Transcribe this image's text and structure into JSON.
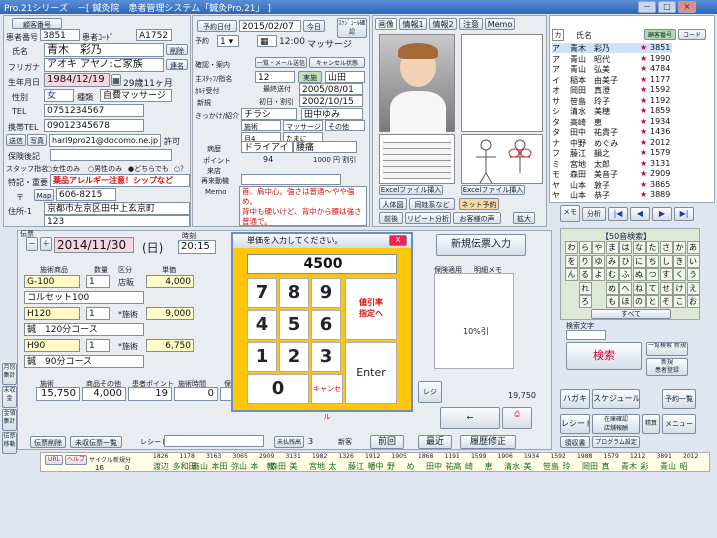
{
  "window": {
    "title": "Pro.21シリーズ　－[ 鍼灸院　患者管理システム「鍼灸Pro.21」 ]",
    "min": "－",
    "max": "□",
    "close": "×"
  },
  "left_top": {
    "print_card": "顧客番号",
    "patient_no_label": "患者番号",
    "patient_no": "3851",
    "barcode_label": "患者ｺｰﾄﾞ",
    "barcode": "A1752",
    "name_label": "氏名",
    "name": "青木　彩乃",
    "kana_label": "フリガナ",
    "kana": "アオキ アヤノ:ご家族",
    "delete_btn": "削除",
    "link_btn": "連名",
    "birth_label": "生年月日",
    "birth": "1984/12/19",
    "age": "29歳11ヶ月",
    "sex_label": "性別",
    "sex": "女",
    "type_label": "種類",
    "type": "自費マッサージ",
    "tel_label": "TEL",
    "tel": "0751234567",
    "mobile_label": "携帯TEL",
    "mobile": "09012345678",
    "mail_btn1": "送信",
    "mail_btn2": "写真",
    "email": "hari9pro21@docomo.ne.jp",
    "permit": "許可",
    "ins_label": "保険後記",
    "staff_label": "スタッフ指名",
    "staff_opts": [
      "女性のみ",
      "男性のみ",
      "どちらでも",
      "？"
    ],
    "note_label": "特記・重要",
    "note": "薬品アレルギー注意！シップなど",
    "zip_label": "〒",
    "map_btn": "Map",
    "zip": "606-8215",
    "addr_label": "住所-1",
    "addr1": "京都市左京区田中上玄京町",
    "addr2": "123"
  },
  "mid_top": {
    "reserve_btn": "予約日付",
    "date": "2015/02/07",
    "today": "今日",
    "schedule_btn": "ｽｹｼﾞｭｰﾙ確認",
    "reserve_label": "予約",
    "time": "12:00",
    "menu": "マッサージ",
    "confirm_label": "確認・案内",
    "list_btn": "一覧・メール送信",
    "cancel_btn": "キャンセル状態",
    "mainstaff_label": "主ｽﾀｯﾌ/指名",
    "mainstaff": "12",
    "actual": "実施",
    "staffname": "山田",
    "visit_label": "ｶﾙﾃ受付",
    "last_label": "最終送付",
    "last": "2005/08/01",
    "first_label": "新規",
    "first_lbl2": "初日・割引",
    "first": "2002/10/15",
    "intro_label": "きっかけ/紹介",
    "intro": "チラシ",
    "intro_name": "田中ゆみ",
    "ref1": "施術",
    "ref2": "マッサージ",
    "ref3": "その他",
    "ref4": "月4",
    "ref5": "たまに",
    "part_label": "病歴",
    "part1": "ドライアイ",
    "part2": "腰痛",
    "point_label": "ポイント",
    "point": "94",
    "yen": "1000 円 割引",
    "shop_label": "来店",
    "shop2": "再来動機",
    "memo_label": "Memo",
    "memo": "首、肩中心。強さは普通〜やや強め。\n背中も硬いけど、背中から腰は強さ普通で。"
  },
  "image_tabs": [
    "画像",
    "情報1",
    "情報2",
    "注意",
    "Memo"
  ],
  "image_panel": {
    "excel1": "Excelファイル挿入",
    "excel2": "Excelファイル挿入",
    "person": "人体図",
    "same": "同姓系など",
    "net": "ネット予約",
    "btns": [
      "前後",
      "リピート分析",
      "お客様の声",
      "拡大"
    ]
  },
  "right_list": {
    "head": [
      "カ",
      "氏名",
      "顧客番号",
      "コード"
    ],
    "rows": [
      {
        "kana": "ア",
        "name": "青木　彩乃",
        "no": "3851",
        "code": "A1752"
      },
      {
        "kana": "ア",
        "name": "青山　昭代",
        "no": "1990",
        "code": ""
      },
      {
        "kana": "ア",
        "name": "青山　弘美",
        "no": "4784",
        "code": ""
      },
      {
        "kana": "イ",
        "name": "稲本　由美子",
        "no": "1177",
        "code": ""
      },
      {
        "kana": "オ",
        "name": "岡田　真澄",
        "no": "1592",
        "code": ""
      },
      {
        "kana": "サ",
        "name": "笹島　玲子",
        "no": "1192",
        "code": ""
      },
      {
        "kana": "シ",
        "name": "清水　美穂",
        "no": "1859",
        "code": ""
      },
      {
        "kana": "タ",
        "name": "高崎　恵",
        "no": "1934",
        "code": ""
      },
      {
        "kana": "タ",
        "name": "田中　祐貴子",
        "no": "1436",
        "code": ""
      },
      {
        "kana": "ナ",
        "name": "中野　めぐみ",
        "no": "2012",
        "code": ""
      },
      {
        "kana": "フ",
        "name": "藤江　韻之",
        "no": "1579",
        "code": ""
      },
      {
        "kana": "ミ",
        "name": "宮地　太郎",
        "no": "3131",
        "code": ""
      },
      {
        "kana": "モ",
        "name": "森田　美音子",
        "no": "2909",
        "code": ""
      },
      {
        "kana": "ヤ",
        "name": "山本　敦子",
        "no": "3865",
        "code": ""
      },
      {
        "kana": "ヤ",
        "name": "山本　恭子",
        "no": "3889",
        "code": ""
      }
    ],
    "memo": "メモ",
    "analysis": "分析"
  },
  "kana_panel": {
    "title": "【50音検索】",
    "rows": [
      [
        "わ",
        "ら",
        "や",
        "ま",
        "は",
        "な",
        "た",
        "さ",
        "か",
        "あ"
      ],
      [
        "を",
        "り",
        "ゆ",
        "み",
        "ひ",
        "に",
        "ち",
        "し",
        "き",
        "い"
      ],
      [
        "ん",
        "る",
        "よ",
        "む",
        "ふ",
        "ぬ",
        "つ",
        "す",
        "く",
        "う"
      ],
      [
        "",
        "れ",
        "",
        "め",
        "へ",
        "ね",
        "て",
        "せ",
        "け",
        "え"
      ],
      [
        "",
        "ろ",
        "",
        "も",
        "ほ",
        "の",
        "と",
        "そ",
        "こ",
        "お"
      ]
    ],
    "all": "すべて",
    "search_label": "検索文字",
    "search_btn": "検索",
    "new_search": "一覧検索 新規",
    "new_reg": "新規\n患者登録"
  },
  "bottom_right": {
    "postcard": "ハガキ",
    "schedule": "スケジュール",
    "num": "予約一覧",
    "receipt": "レシート",
    "recv": "在庫確認\n店舗報酬",
    "payday": "精算",
    "ledger": "領収書",
    "prog": "プログラム設定",
    "menu": "メニュー"
  },
  "slip": {
    "label": "伝票",
    "date": "2014/11/30",
    "dow": "(日)",
    "time_label": "時刻",
    "time": "20:15",
    "new_slip": "新規伝票入力",
    "headers": [
      "施術商品",
      "数量",
      "区分",
      "単価"
    ],
    "items": [
      {
        "code": "G-100",
        "qty": "1",
        "kind": "店販",
        "price": "4,000"
      },
      {
        "code": "コルセット100",
        "qty": "",
        "kind": "",
        "price": ""
      },
      {
        "code": "H120",
        "qty": "1",
        "kind": "*施術",
        "price": "9,000"
      },
      {
        "code": "鍼　120分コース",
        "qty": "",
        "kind": "",
        "price": ""
      },
      {
        "code": "H90",
        "qty": "1",
        "kind": "*施術",
        "price": "6,750"
      },
      {
        "code": "鍼　90分コース",
        "qty": "",
        "kind": "",
        "price": ""
      }
    ],
    "tot_headers": [
      "施術",
      "商品その他",
      "患者ポイント",
      "施術時間",
      "保険適用"
    ],
    "tot_vals": [
      "15,750",
      "4,000",
      "19",
      "0",
      ""
    ],
    "memo_headers": [
      "保険適用",
      "明細メモ"
    ],
    "discount": "10%引",
    "total": "19,750",
    "register": "レジ",
    "delete": "伝票削除",
    "list": "未収伝票一覧",
    "receipt": "レシート",
    "pay": "未払残高",
    "count": "3",
    "new": "新客",
    "prev": "前回",
    "latest": "最近",
    "history": "履歴修正"
  },
  "dialog": {
    "title": "単価を入力してください。",
    "value": "4500",
    "keys": [
      "7",
      "8",
      "9",
      "4",
      "5",
      "6",
      "1",
      "2",
      "3",
      "0"
    ],
    "disc": "値引率\n指定へ",
    "cancel": "キャンセル",
    "enter": "Enter",
    "close": "X"
  },
  "bottom_strip": {
    "url": "URL",
    "help": "ヘルプ",
    "cycle": "サイクル",
    "visit": "新規分",
    "cyc_v": "16",
    "vis_v": "0",
    "nums": [
      "1826",
      "1178",
      "3163",
      "3065",
      "2909",
      "3131",
      "1982",
      "1326",
      "1912",
      "1905",
      "1868",
      "1191",
      "1599",
      "1906",
      "1934",
      "1592",
      "1988",
      "1579",
      "1212",
      "3891",
      "2012"
    ],
    "names": [
      "渡辺",
      "多和田",
      "商山",
      "本田",
      "弥山",
      "本　教",
      "森田",
      "美",
      "宮地",
      "太",
      "藤江",
      "幡中",
      "野",
      "め",
      "田中",
      "祐高",
      "崎",
      "恵",
      "清水",
      "美",
      "笹島",
      "玲",
      "岡田",
      "真",
      "青木",
      "彩",
      "青山",
      "昭"
    ]
  },
  "side_tabs": [
    "月別集計",
    "未収金",
    "金領集計",
    "伝票移動"
  ]
}
